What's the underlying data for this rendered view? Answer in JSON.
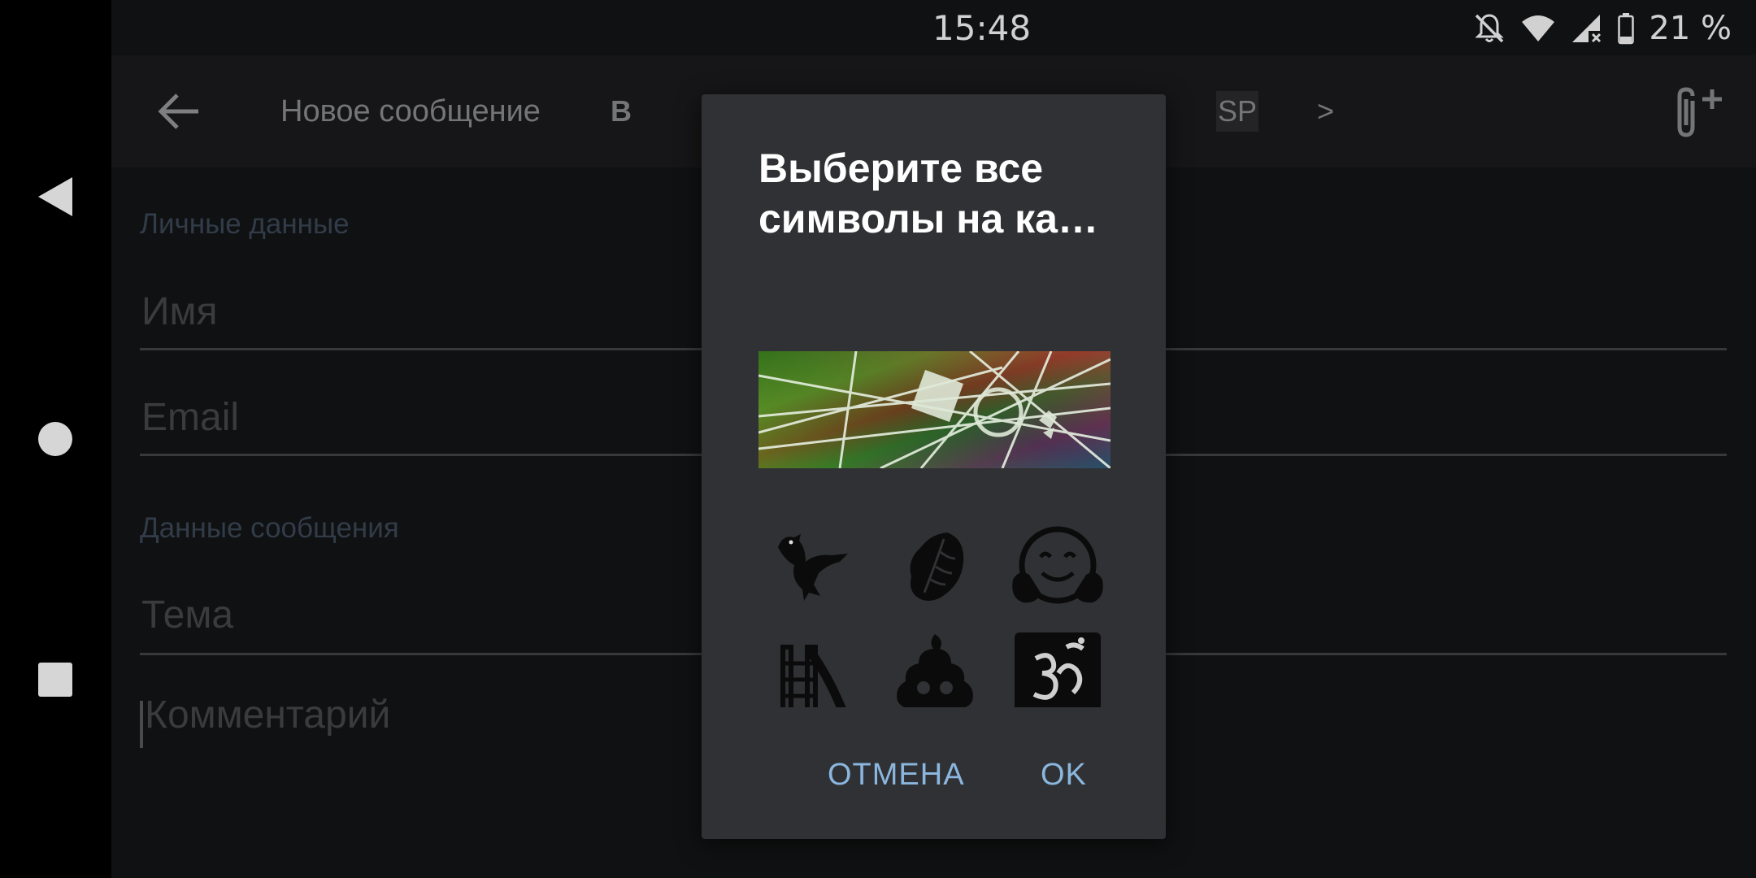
{
  "status_bar": {
    "time": "15:48",
    "battery": "21 %"
  },
  "nav": {
    "back": "back-triangle",
    "home": "home-circle",
    "recents": "recents-square"
  },
  "toolbar": {
    "title": "Новое сообщение",
    "bold_label": "B",
    "sp_label": "SP",
    "next_label": ">"
  },
  "form": {
    "personal_section": "Личные данные",
    "name_placeholder": "Имя",
    "email_placeholder": "Email",
    "message_section": "Данные сообщения",
    "subject_placeholder": "Тема",
    "comment_placeholder": "Комментарий"
  },
  "dialog": {
    "title": "Выберите все символы на ка…",
    "cancel": "ОТМЕНА",
    "ok": "OK",
    "options": [
      "eagle-icon",
      "lettuce-icon",
      "hugging-face-icon",
      "slide-icon",
      "poop-icon",
      "om-symbol-icon"
    ]
  },
  "colors": {
    "accent": "#8bb6de",
    "dialog_bg": "#303134",
    "page_bg": "#141517"
  }
}
